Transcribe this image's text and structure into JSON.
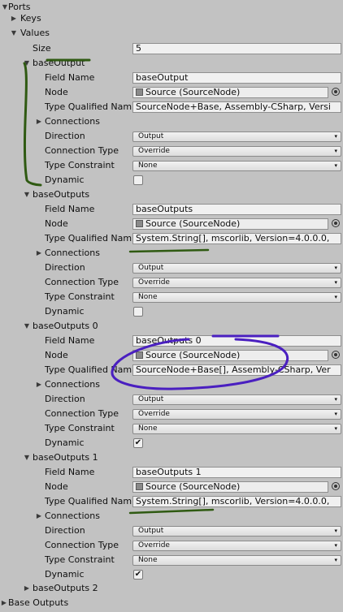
{
  "ports_label": "Ports",
  "keys_label": "Keys",
  "values_label": "Values",
  "size": {
    "label": "Size",
    "value": "5"
  },
  "field_labels": {
    "field_name": "Field Name",
    "node": "Node",
    "type_qualified": "Type Qualified Nam",
    "connections": "Connections",
    "direction": "Direction",
    "connection_type": "Connection Type",
    "type_constraint": "Type Constraint",
    "dynamic": "Dynamic"
  },
  "elements": [
    {
      "header": "baseOutput",
      "field_name": "baseOutput",
      "node": "Source (SourceNode)",
      "type_qualified": "SourceNode+Base, Assembly-CSharp, Versi",
      "direction": "Output",
      "connection_type": "Override",
      "type_constraint": "None",
      "dynamic": false
    },
    {
      "header": "baseOutputs",
      "field_name": "baseOutputs",
      "node": "Source (SourceNode)",
      "type_qualified": "System.String[], mscorlib, Version=4.0.0.0,",
      "direction": "Output",
      "connection_type": "Override",
      "type_constraint": "None",
      "dynamic": false
    },
    {
      "header": "baseOutputs 0",
      "field_name": "baseOutputs 0",
      "node": "Source (SourceNode)",
      "type_qualified": "SourceNode+Base[], Assembly-CSharp, Ver",
      "direction": "Output",
      "connection_type": "Override",
      "type_constraint": "None",
      "dynamic": true
    },
    {
      "header": "baseOutputs 1",
      "field_name": "baseOutputs 1",
      "node": "Source (SourceNode)",
      "type_qualified": "System.String[], mscorlib, Version=4.0.0.0,",
      "direction": "Output",
      "connection_type": "Override",
      "type_constraint": "None",
      "dynamic": true
    }
  ],
  "collapsed_element": "baseOutputs 2",
  "base_outputs_label": "Base Outputs",
  "annotation_colors": {
    "green": "#2f5a12",
    "purple": "#4a1fc0"
  },
  "icons": {
    "expanded": "triangle-down-icon",
    "collapsed": "triangle-right-icon",
    "dropdown": "dropdown-arrow-icon",
    "picker": "object-picker-icon",
    "checkbox": "checkmark-icon"
  }
}
